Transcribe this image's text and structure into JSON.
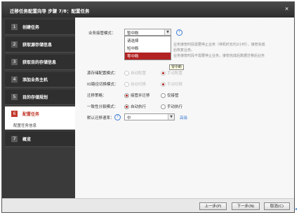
{
  "window": {
    "title": "迁移任务配置向导 步骤 7/8：配置任务",
    "close_icon": "close-icon"
  },
  "sidebar": {
    "steps": [
      {
        "num": "1",
        "label": "创建任务"
      },
      {
        "num": "2",
        "label": "获取源存储信息"
      },
      {
        "num": "3",
        "label": "获取目的存储信息"
      },
      {
        "num": "4",
        "label": "添加业务主机"
      },
      {
        "num": "5",
        "label": "目的存储规划"
      },
      {
        "num": "6",
        "label": "配置任务"
      },
      {
        "num": "7",
        "label": "概览"
      }
    ],
    "substep": "配置任务信息"
  },
  "form": {
    "business_switch_label": "业务接管模式：",
    "business_switch_value": "暂中断",
    "desc_line1": "业务接管时段需要停止业务（停机时长约2小时），接管完成",
    "desc_line2": "后恢复业务。",
    "desc_line3": "业务接管时段不需要停止业务，接管完成后数据迁移后业务",
    "dropdown_options": [
      "请选择",
      "短中断",
      "零中断"
    ],
    "dropdown_selected_index": 2,
    "tooltip": "零中断",
    "source_config_label": "源存储配置模式：",
    "source_opt_a": "自动配置",
    "source_opt_b": "手动配置",
    "io_label": "IO路径切换模式：",
    "io_opt_a": "自动切换",
    "io_opt_b": "手动切换",
    "strategy_label": "迁移策略：",
    "strategy_opt_a": "接管并迁移",
    "strategy_opt_b": "仅接管",
    "consistency_label": "一致性分裂模式：",
    "consistency_opt_a": "自动执行",
    "consistency_opt_b": "手动执行",
    "speed_label": "默认迁移速率：",
    "speed_value": "中",
    "speed_link": "高级"
  },
  "footer": {
    "prev": "上一步(P)",
    "next": "下一步(N)",
    "cancel": "取消(C)"
  },
  "colors": {
    "accent": "#b22222",
    "titlebar": "#3a3a3a",
    "link": "#3a7bd5"
  }
}
